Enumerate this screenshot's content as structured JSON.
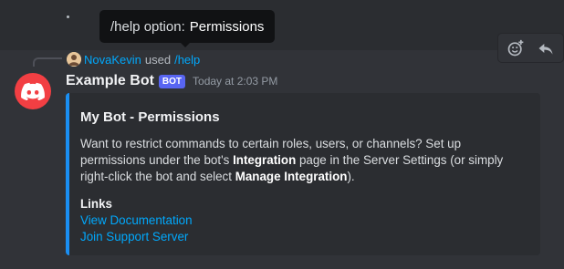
{
  "tooltip": {
    "prefix": "/help option:",
    "value": "Permissions"
  },
  "hover_bar": {
    "icons": [
      "add-reaction-icon",
      "reply-icon"
    ]
  },
  "reply": {
    "username": "NovaKevin",
    "used_text": "used",
    "command": "/help"
  },
  "message": {
    "author": "Example Bot",
    "tag": "BOT",
    "timestamp": "Today at 2:03 PM"
  },
  "embed": {
    "title": "My Bot - Permissions",
    "accent_color": "#1a8ff3",
    "description": {
      "part1": "Want to restrict commands to certain roles, users, or channels? Set up permissions under the bot's ",
      "bold1": "Integration",
      "part2": " page in the Server Settings (or simply right-click the bot and select ",
      "bold2": "Manage Integration",
      "part3": ")."
    },
    "field_name": "Links",
    "links": [
      "View Documentation",
      "Join Support Server"
    ]
  }
}
